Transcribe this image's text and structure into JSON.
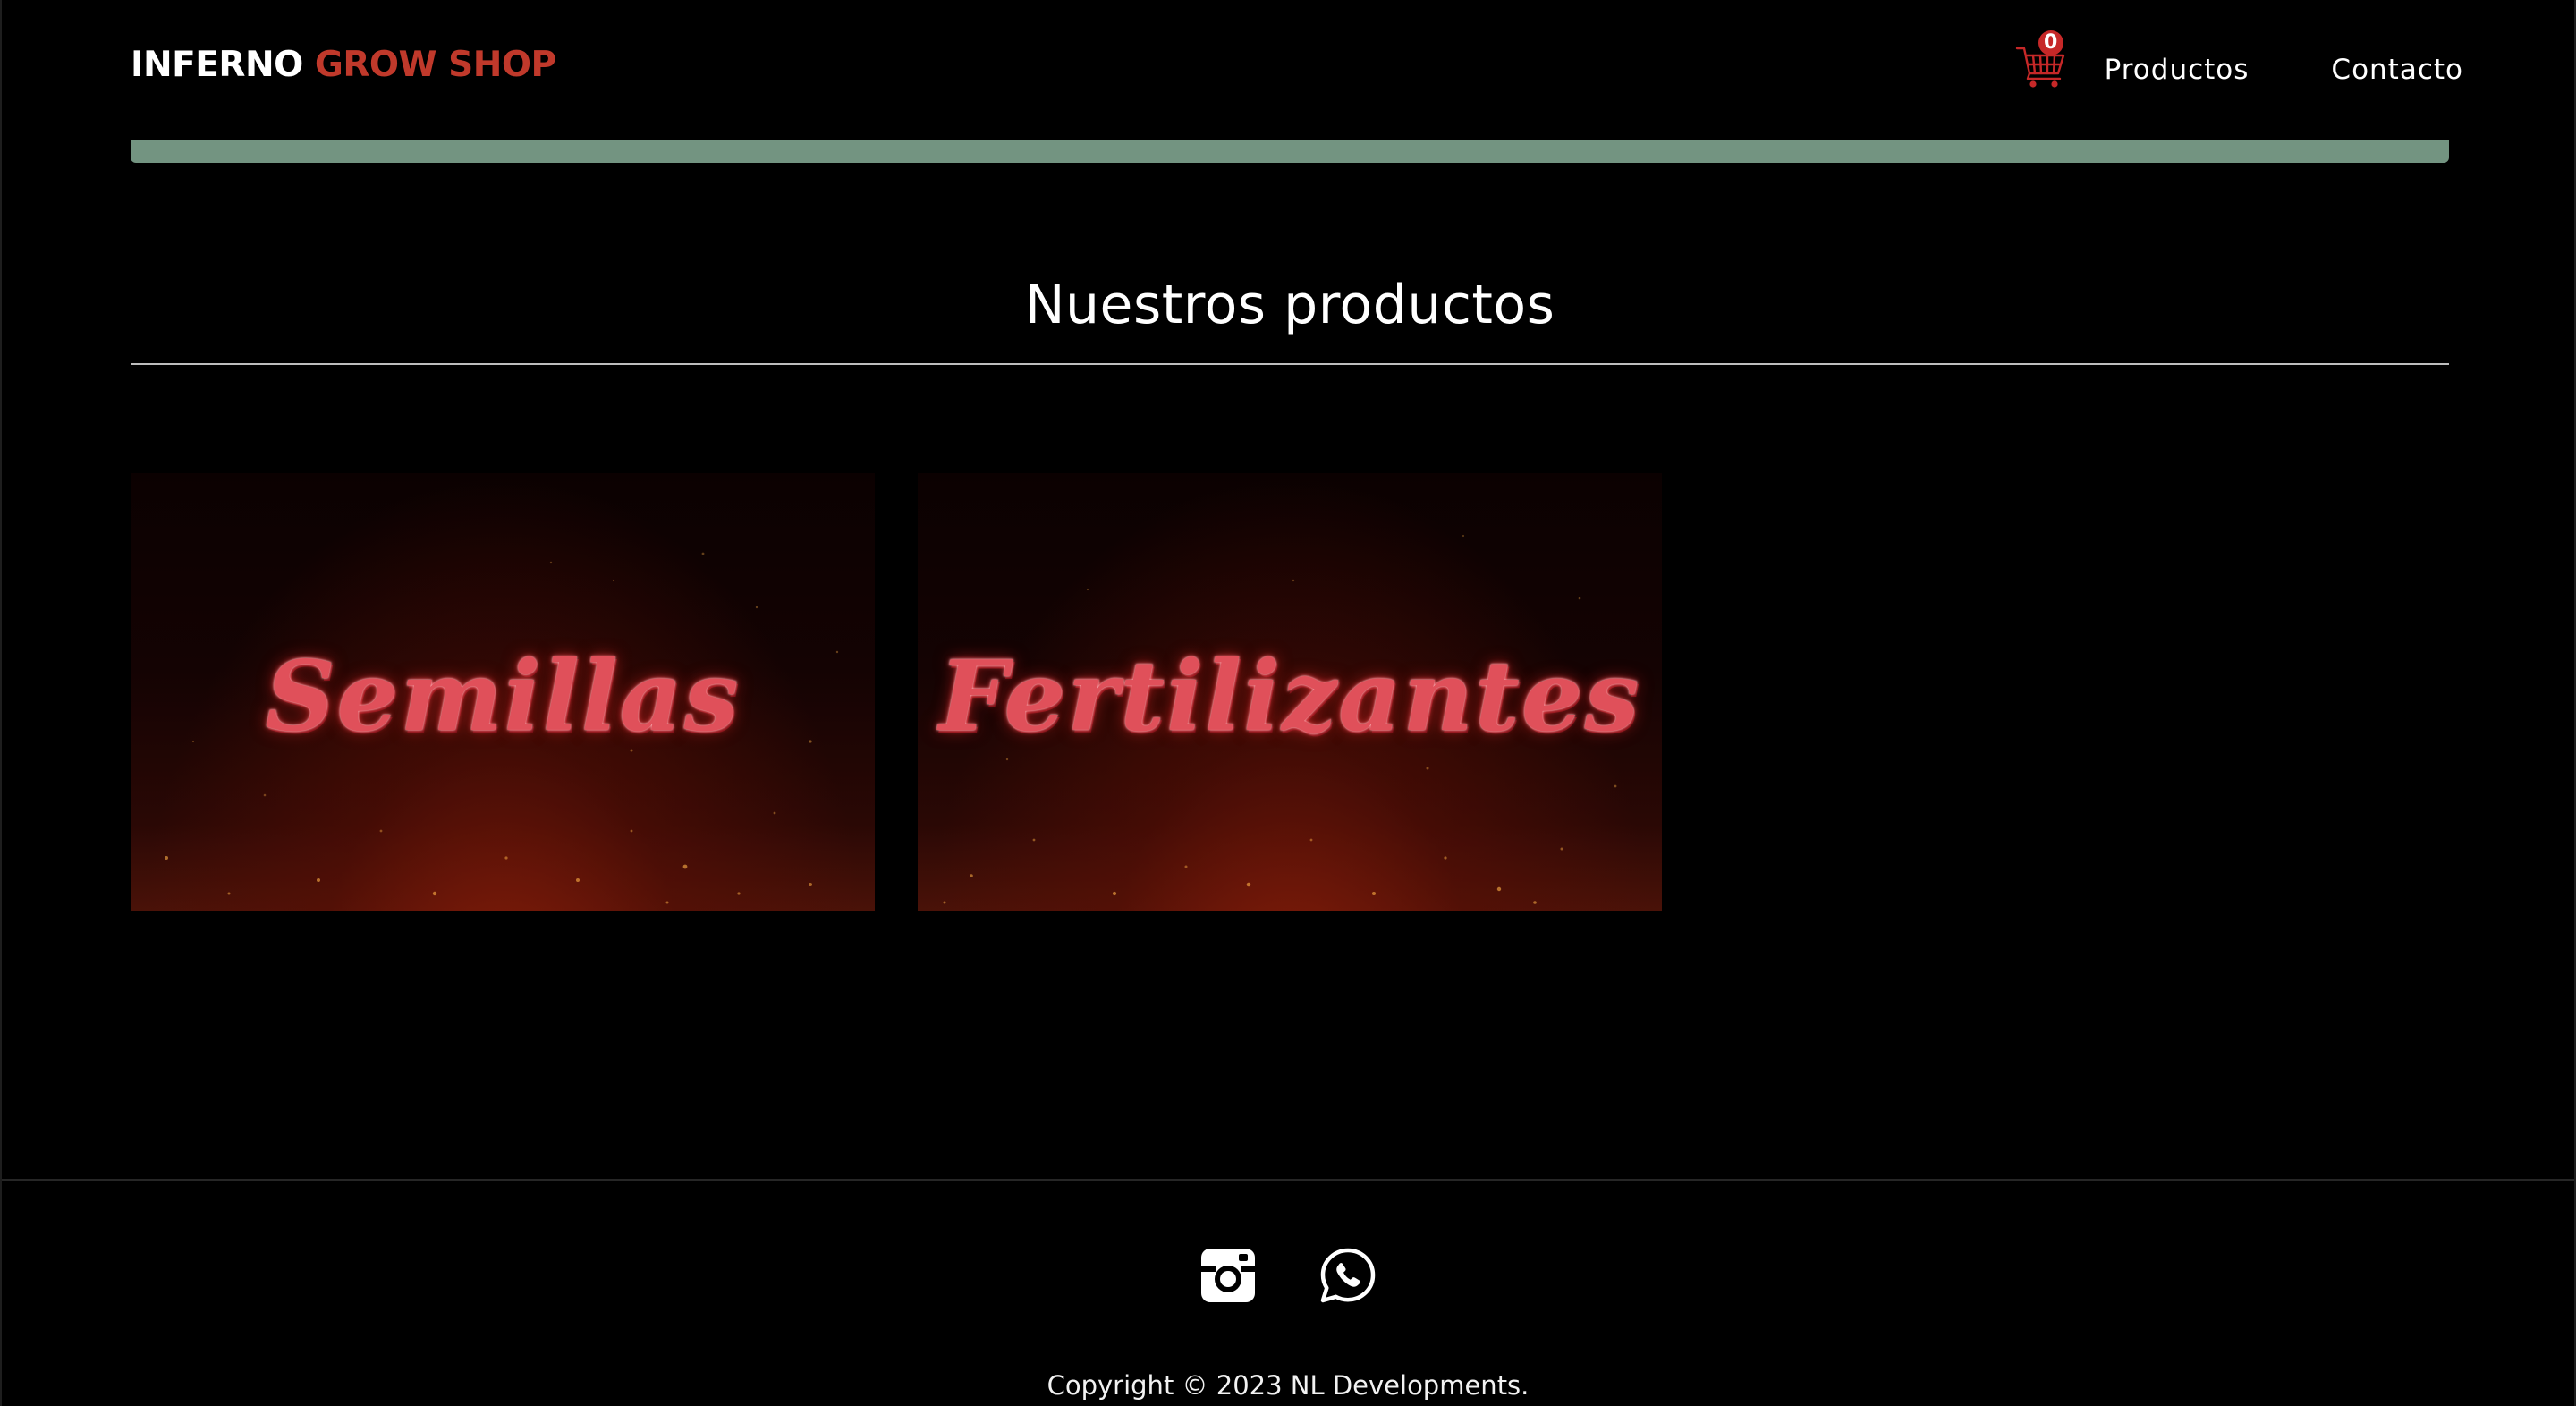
{
  "header": {
    "brand_part1": "INFERNO",
    "brand_part2": "GROW SHOP",
    "cart_count": "0",
    "nav": [
      {
        "label": "Productos"
      },
      {
        "label": "Contacto"
      }
    ]
  },
  "colors": {
    "background": "#000000",
    "accent_red": "#c0392b",
    "bar_green": "#739481",
    "badge_red": "#c62828"
  },
  "main": {
    "section_title": "Nuestros productos",
    "products": [
      {
        "label": "Semillas"
      },
      {
        "label": "Fertilizantes"
      }
    ]
  },
  "footer": {
    "social_icons": [
      "instagram-icon",
      "whatsapp-icon"
    ],
    "copyright": "Copyright © 2023 NL Developments."
  }
}
